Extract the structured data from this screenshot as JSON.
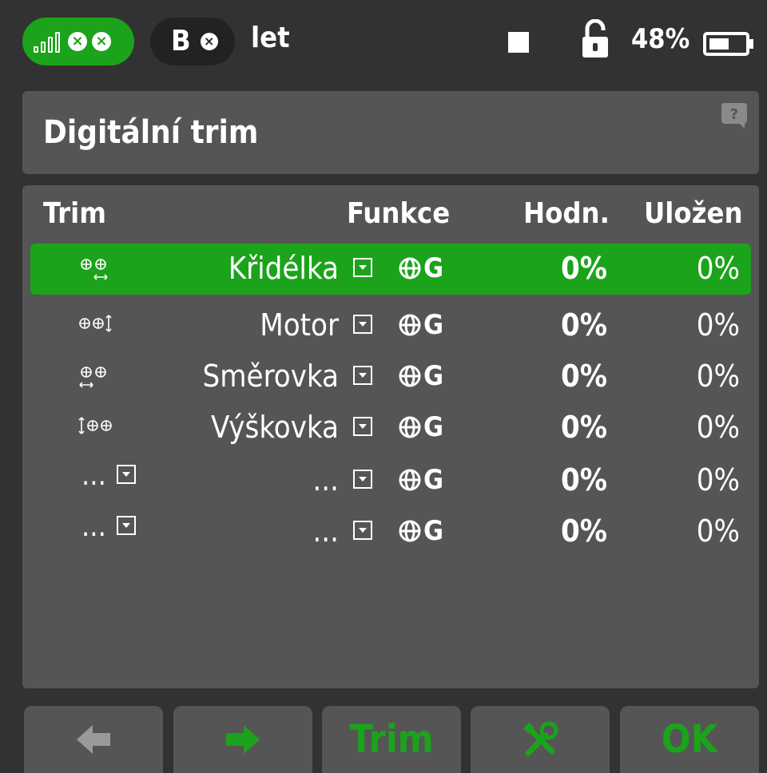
{
  "topbar": {
    "model_letter": "B",
    "model_name": "let",
    "battery": "48%"
  },
  "title": "Digitální trim",
  "headers": {
    "trim": "Trim",
    "function": "Funkce",
    "value": "Hodn.",
    "saved": "Uložen"
  },
  "rows": [
    {
      "trim": "",
      "function": "Křidélka",
      "g": "G",
      "value": "0%",
      "saved": "0%"
    },
    {
      "trim": "",
      "function": "Motor",
      "g": "G",
      "value": "0%",
      "saved": "0%"
    },
    {
      "trim": "",
      "function": "Směrovka",
      "g": "G",
      "value": "0%",
      "saved": "0%"
    },
    {
      "trim": "",
      "function": "Výškovka",
      "g": "G",
      "value": "0%",
      "saved": "0%"
    },
    {
      "trim": "...",
      "function": "...",
      "g": "G",
      "value": "0%",
      "saved": "0%"
    },
    {
      "trim": "...",
      "function": "...",
      "g": "G",
      "value": "0%",
      "saved": "0%"
    }
  ],
  "buttons": {
    "trim": "Trim",
    "ok": "OK"
  },
  "colors": {
    "accent": "#1ba31b",
    "panel": "#555555",
    "background": "#323232"
  }
}
